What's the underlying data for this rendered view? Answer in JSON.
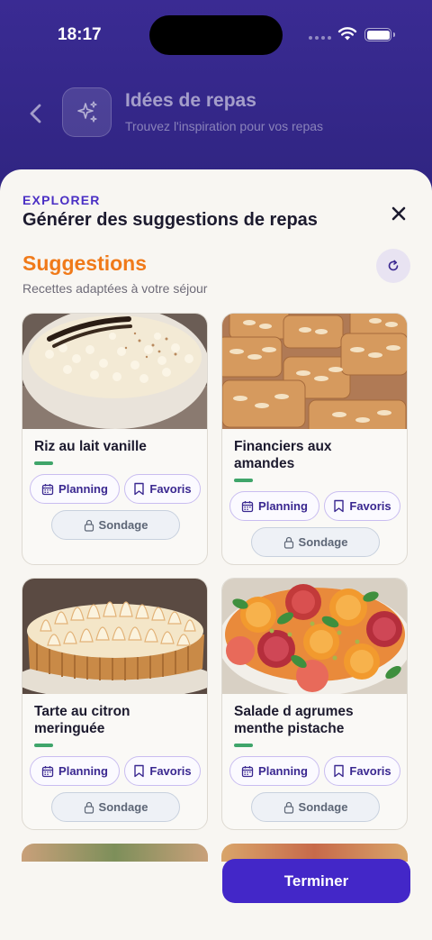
{
  "status_bar": {
    "time": "18:17"
  },
  "header": {
    "title": "Idées de repas",
    "subtitle": "Trouvez l'inspiration pour vos repas",
    "icon": "sparkles-icon"
  },
  "sheet": {
    "eyebrow": "EXPLORER",
    "title": "Générer des suggestions de repas",
    "section_title": "Suggestions",
    "section_subtitle": "Recettes adaptées à votre séjour"
  },
  "cards": [
    {
      "name": "Riz au lait vanille",
      "planning": "Planning",
      "favoris": "Favoris",
      "sondage": "Sondage"
    },
    {
      "name": "Financiers aux amandes",
      "planning": "Planning",
      "favoris": "Favoris",
      "sondage": "Sondage"
    },
    {
      "name": "Tarte au citron meringuée",
      "planning": "Planning",
      "favoris": "Favoris",
      "sondage": "Sondage"
    },
    {
      "name": "Salade d agrumes menthe pistache",
      "planning": "Planning",
      "favoris": "Favoris",
      "sondage": "Sondage"
    }
  ],
  "footer": {
    "finish_label": "Terminer"
  },
  "colors": {
    "header_bg": "#3a2b93",
    "accent_purple": "#4327c8",
    "section_orange": "#f07a1a",
    "accent_green": "#3fa56a"
  }
}
